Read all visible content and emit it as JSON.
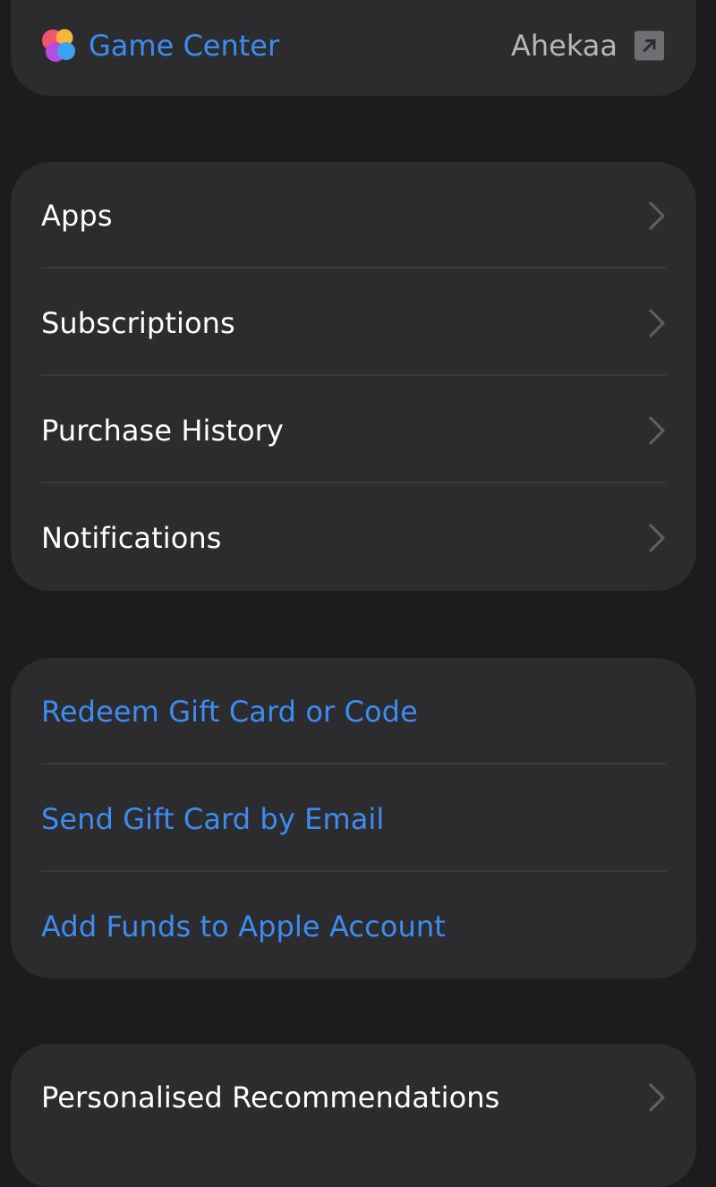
{
  "game_center": {
    "title": "Game Center",
    "user": "Ahekaa"
  },
  "menu": {
    "items": [
      {
        "label": "Apps"
      },
      {
        "label": "Subscriptions"
      },
      {
        "label": "Purchase History"
      },
      {
        "label": "Notifications"
      }
    ]
  },
  "gift": {
    "items": [
      {
        "label": "Redeem Gift Card or Code"
      },
      {
        "label": "Send Gift Card by Email"
      },
      {
        "label": "Add Funds to Apple Account"
      }
    ]
  },
  "more": {
    "items": [
      {
        "label": "Personalised Recommendations"
      }
    ]
  },
  "colors": {
    "background": "#1c1c1e",
    "card": "#2c2c2e",
    "accent": "#3d8cf0",
    "text": "#ffffff",
    "secondary_text": "#b7b7bb",
    "chevron": "#5e5e63"
  },
  "icons": {
    "game_center": "game-center-icon",
    "external_link": "external-link-icon",
    "chevron": "chevron-right-icon"
  }
}
